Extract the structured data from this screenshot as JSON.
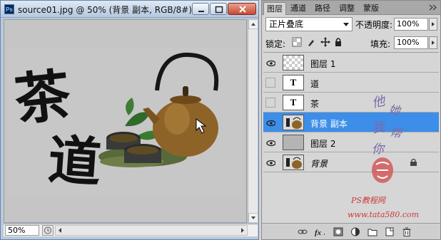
{
  "document": {
    "title": "source01.jpg @ 50% (背景 副本, RGB/8#) *",
    "ps_badge": "Ps",
    "zoom": "50%"
  },
  "artwork": {
    "calligraphy_char_1": "茶",
    "calligraphy_char_2": "道"
  },
  "panel": {
    "tabs": [
      {
        "label": "图层",
        "active": true
      },
      {
        "label": "通道",
        "active": false
      },
      {
        "label": "路径",
        "active": false
      },
      {
        "label": "调整",
        "active": false
      },
      {
        "label": "蒙版",
        "active": false
      }
    ],
    "blend_mode": "正片叠底",
    "opacity_label": "不透明度:",
    "opacity_value": "100%",
    "lock_label": "锁定:",
    "fill_label": "填充:",
    "fill_value": "100%"
  },
  "layers": [
    {
      "name": "图层 1",
      "visible": true,
      "thumb": "checker",
      "selected": false
    },
    {
      "name": "道",
      "visible": false,
      "thumb": "text",
      "selected": false
    },
    {
      "name": "茶",
      "visible": false,
      "thumb": "text",
      "selected": false
    },
    {
      "name": "背景 副本",
      "visible": true,
      "thumb": "teapot",
      "selected": true
    },
    {
      "name": "图层 2",
      "visible": true,
      "thumb": "gray",
      "selected": false
    },
    {
      "name": "背景",
      "visible": true,
      "thumb": "teapot",
      "selected": false,
      "locked": true
    }
  ],
  "text_layer_glyph": "T",
  "watermark": {
    "handwriting_line_1": "他",
    "handwriting_line_2": "她",
    "handwriting_line_3": "我",
    "handwriting_line_4": "帮",
    "handwriting_line_5": "你",
    "site_name": "PS教程网",
    "site_url": "www.tata580.com"
  },
  "colors": {
    "selected_row": "#3d8ee8",
    "watermark_red": "#cc3a3a",
    "watermark_violet": "#7a6aa8"
  }
}
